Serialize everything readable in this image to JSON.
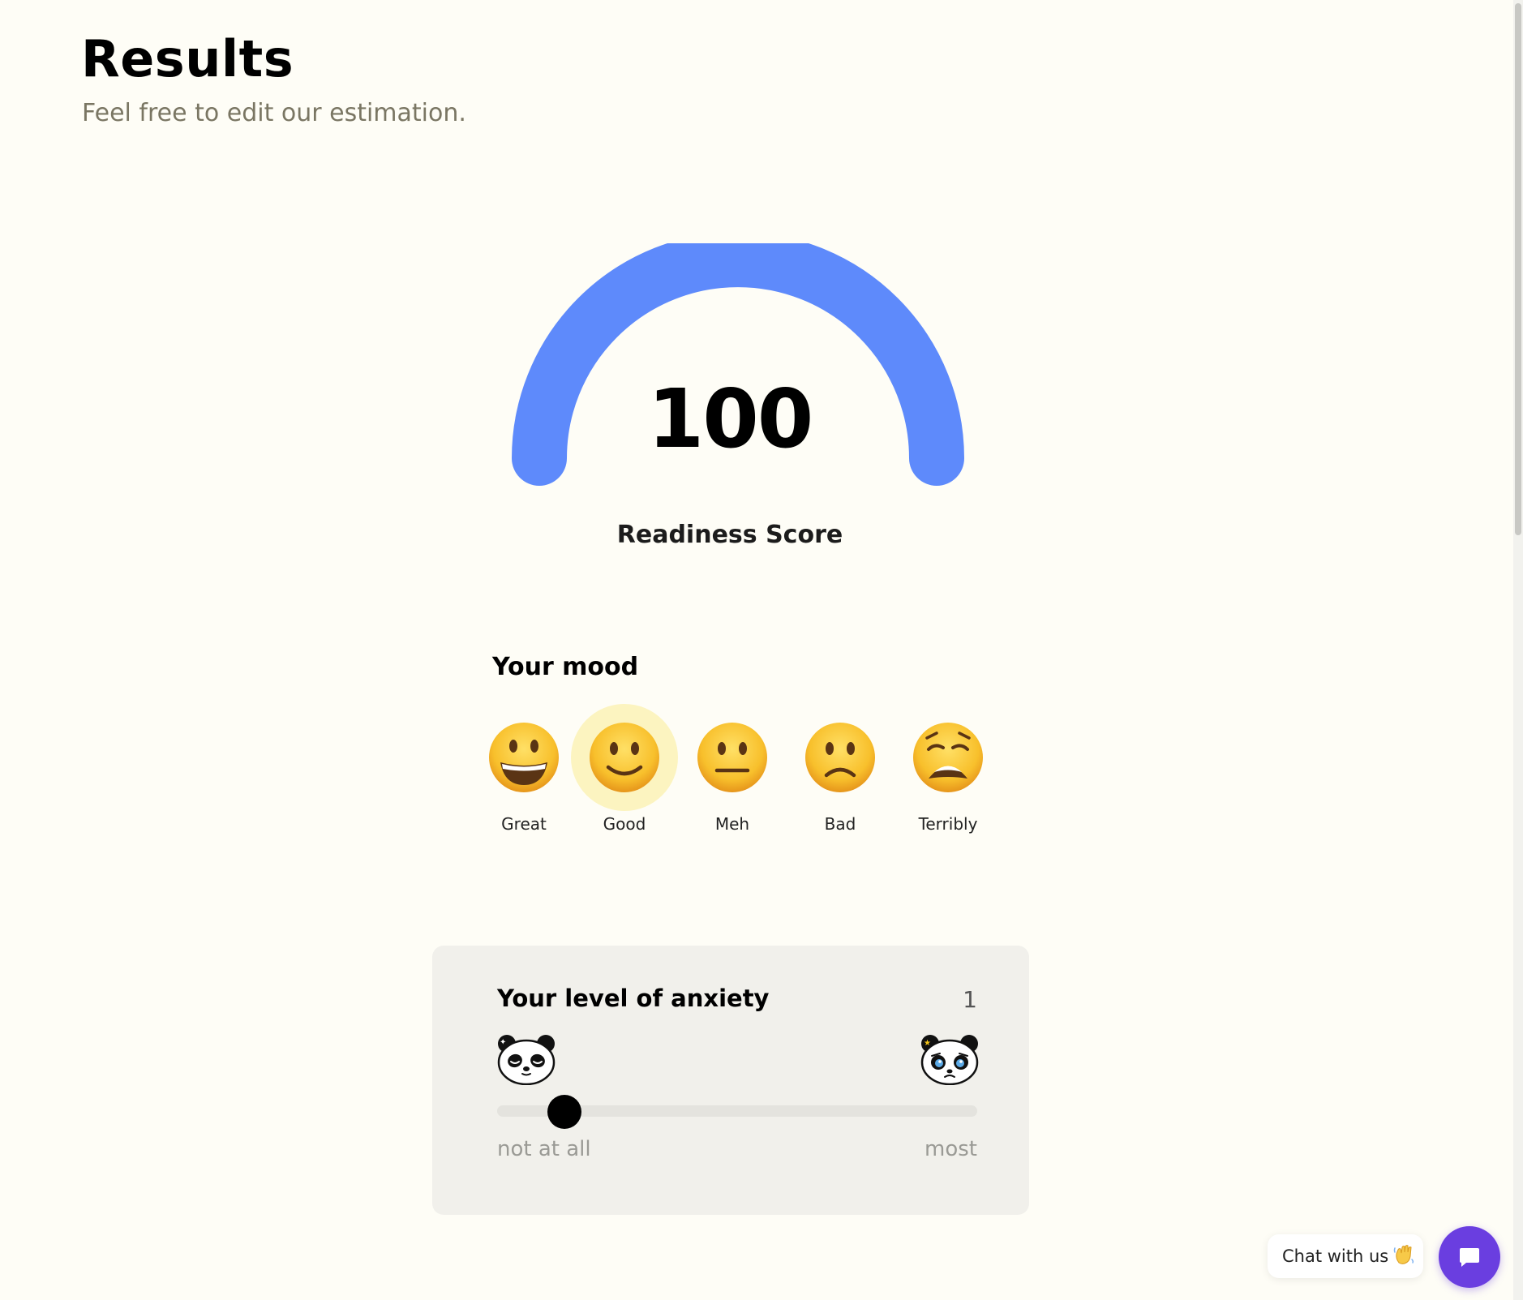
{
  "header": {
    "title": "Results",
    "subtitle": "Feel free to edit our estimation."
  },
  "score": {
    "value": "100",
    "label": "Readiness Score",
    "fraction": 1.0,
    "color": "#5e8afb"
  },
  "mood": {
    "title": "Your mood",
    "selected": "Good",
    "options": [
      {
        "label": "Great",
        "icon": "grinning-face-icon"
      },
      {
        "label": "Good",
        "icon": "slightly-smiling-face-icon"
      },
      {
        "label": "Meh",
        "icon": "neutral-face-icon"
      },
      {
        "label": "Bad",
        "icon": "slightly-frowning-face-icon"
      },
      {
        "label": "Terribly",
        "icon": "weary-face-icon"
      }
    ]
  },
  "anxiety": {
    "title": "Your level of anxiety",
    "value": "1",
    "min_label": "not at all",
    "max_label": "most",
    "slider_fraction": 0.14,
    "left_icon": "calm-panda-icon",
    "right_icon": "crying-panda-icon"
  },
  "chat": {
    "label": "Chat with us",
    "wave_icon": "waving-hand-icon",
    "button_icon": "chat-bubble-icon",
    "accent": "#6a3ee0"
  }
}
